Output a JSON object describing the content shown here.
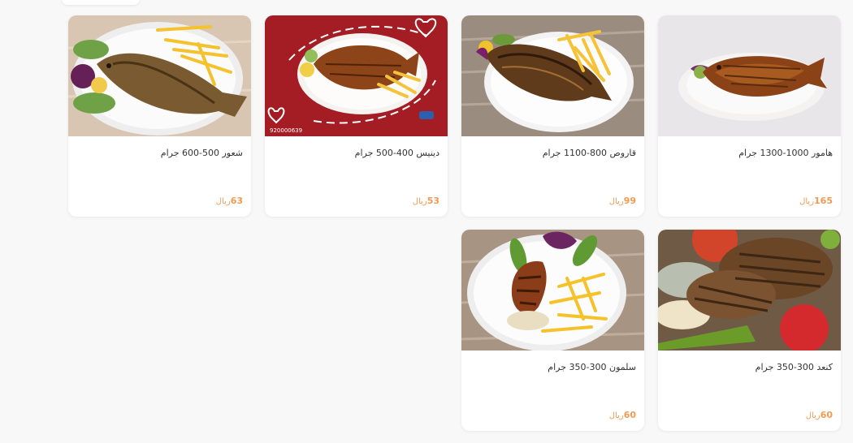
{
  "products": [
    {
      "name": "هامور 1000-1300 جرام",
      "price": "165",
      "currency": "ريال",
      "image": "grilled-hammour-photo"
    },
    {
      "name": "قاروص 800-1100 جرام",
      "price": "99",
      "currency": "ريال",
      "image": "grilled-seabass-photo"
    },
    {
      "name": "دينيس 400-500 جرام",
      "price": "53",
      "currency": "ريال",
      "image": "dennis-promo-photo"
    },
    {
      "name": "شعور 500-600 جرام",
      "price": "63",
      "currency": "ريال",
      "image": "fried-shaour-photo"
    },
    {
      "name": "كنعد 300-350 جرام",
      "price": "60",
      "currency": "ريال",
      "image": "kingfish-steaks-photo"
    },
    {
      "name": "سلمون 300-350 جرام",
      "price": "60",
      "currency": "ريال",
      "image": "salmon-steak-photo"
    }
  ],
  "promo": {
    "phone": "920000639"
  },
  "colors": {
    "price": "#f29a52",
    "page_bg": "#f8f8f8",
    "promo_bg": "#a51d24"
  }
}
